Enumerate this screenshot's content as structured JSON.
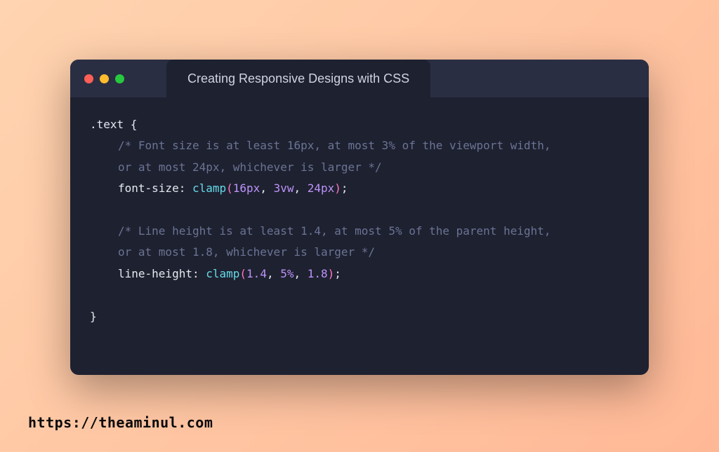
{
  "window": {
    "tab_title": "Creating Responsive Designs with CSS"
  },
  "code": {
    "selector": ".text",
    "open_brace": " {",
    "close_brace": "}",
    "comment1_line1": "/* Font size is at least 16px, at most 3% of the viewport width,",
    "comment1_line2": "or at most 24px, whichever is larger */",
    "prop1_name": "font-size",
    "colon": ": ",
    "func_name": "clamp",
    "open_paren": "(",
    "close_paren": ")",
    "semicolon": ";",
    "comma_sp": ", ",
    "val1_a": "16px",
    "val1_b": "3vw",
    "val1_c": "24px",
    "comment2_line1": "/* Line height is at least 1.4, at most 5% of the parent height,",
    "comment2_line2": "or at most 1.8, whichever is larger */",
    "prop2_name": "line-height",
    "val2_a": "1.4",
    "val2_b": "5%",
    "val2_c": "1.8"
  },
  "footer": {
    "url": "https://theaminul.com"
  }
}
